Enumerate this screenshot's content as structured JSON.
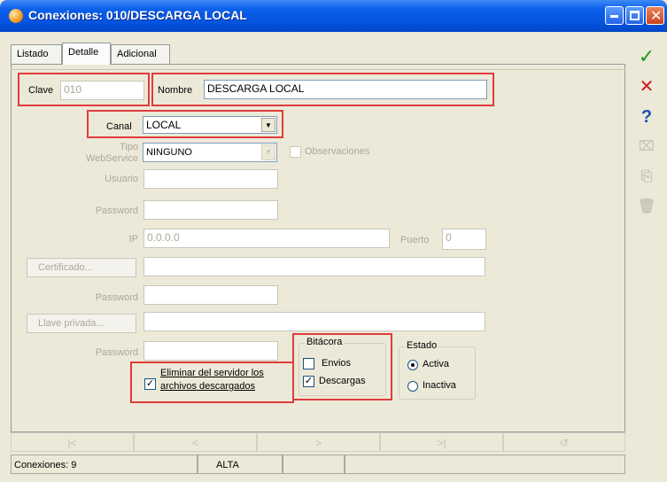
{
  "window": {
    "title": "Conexiones: 010/DESCARGA LOCAL"
  },
  "tabs": [
    {
      "label": "Listado"
    },
    {
      "label": "Detalle"
    },
    {
      "label": "Adicional"
    }
  ],
  "form": {
    "clave_label": "Clave",
    "clave_value": "010",
    "nombre_label": "Nombre",
    "nombre_value": "DESCARGA LOCAL",
    "canal_label": "Canal",
    "canal_value": "LOCAL",
    "tipo_ws_label_1": "Tipo",
    "tipo_ws_label_2": "WebService",
    "tipo_ws_value": "NINGUNO",
    "observaciones_label": "Observaciones",
    "usuario_label": "Usuario",
    "usuario_value": "",
    "password1_label": "Password",
    "password1_value": "",
    "ip_label": "IP",
    "ip_value": "0.0.0.0",
    "puerto_label": "Puerto",
    "puerto_value": "0",
    "certificado_button": "Certificado...",
    "certificado_value": "",
    "password2_label": "Password",
    "password2_value": "",
    "llave_button": "Llave privada...",
    "llave_value": "",
    "password3_label": "Password",
    "password3_value": "",
    "eliminar_label_1": "Eliminar del servidor los",
    "eliminar_label_2": "archivos descargados",
    "eliminar_checked": true
  },
  "bitacora": {
    "title": "Bitácora",
    "envios_label": "Envios",
    "envios_checked": false,
    "descargas_label": "Descargas",
    "descargas_checked": true
  },
  "estado": {
    "title": "Estado",
    "activa_label": "Activa",
    "inactiva_label": "Inactiva",
    "selected": "Activa"
  },
  "navigation": [
    "|<",
    "<",
    ">",
    ">|",
    "↺"
  ],
  "statusbar": {
    "count": "Conexiones: 9",
    "mode": "ALTA"
  },
  "sidebar": {
    "accept_icon": "check-icon",
    "cancel_icon": "x-icon",
    "help_icon": "question-icon",
    "accept_color": "#1a9a1a",
    "cancel_color": "#c81e1e",
    "help_color": "#1e4fb4"
  }
}
